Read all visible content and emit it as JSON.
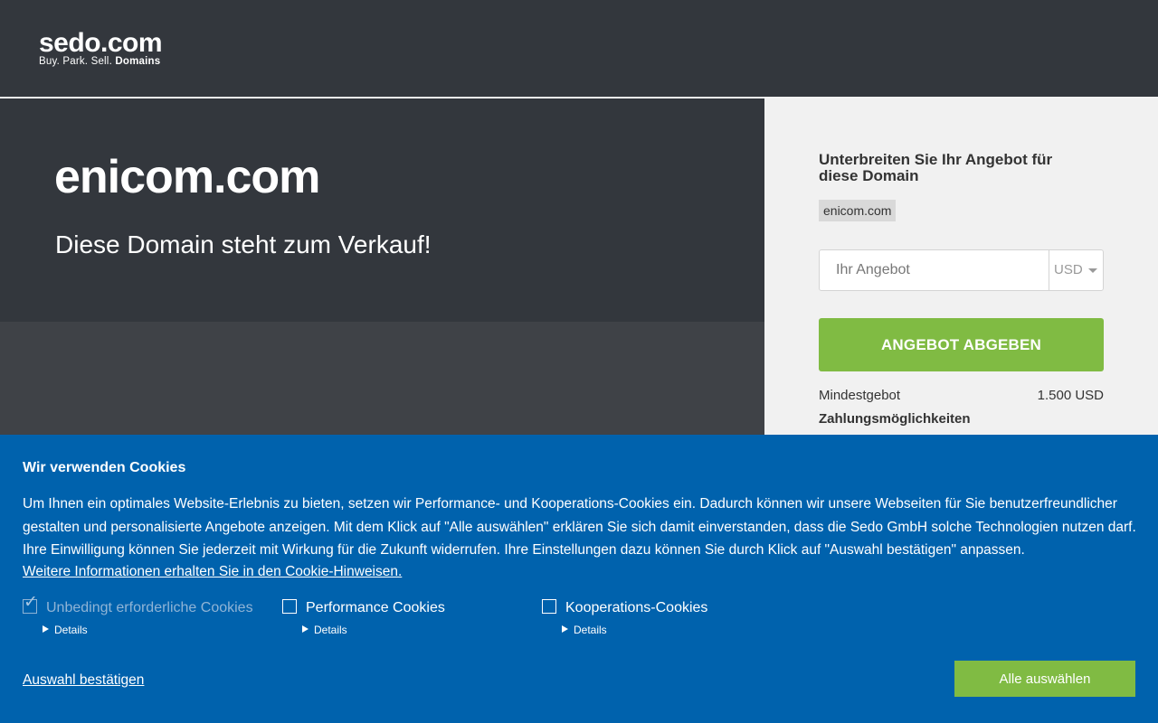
{
  "header": {
    "logo_main": "sedo.com",
    "logo_tagline_prefix": "Buy.  Park.  Sell.",
    "logo_tagline_bold": "Domains"
  },
  "hero": {
    "domain": "enicom.com",
    "subtitle": "Diese Domain steht zum Verkauf!"
  },
  "offer": {
    "heading": "Unterbreiten Sie Ihr Angebot für diese Domain",
    "domain_chip": "enicom.com",
    "input_placeholder": "Ihr Angebot",
    "currency": "USD",
    "button_label": "ANGEBOT ABGEBEN",
    "min_bid_label": "Mindestgebot",
    "min_bid_value": "1.500 USD",
    "payment_label": "Zahlungsmöglichkeiten"
  },
  "cookies": {
    "title": "Wir verwenden Cookies",
    "text": "Um Ihnen ein optimales Website-Erlebnis zu bieten, setzen wir Performance- und Kooperations-Cookies ein. Dadurch können wir unsere Webseiten für Sie benutzerfreundlicher gestalten und personalisierte Angebote anzeigen. Mit dem Klick auf \"Alle auswählen\" erklären Sie sich damit einverstanden, dass die Sedo GmbH solche Technologien nutzen darf. Ihre Einwilligung können Sie jederzeit mit Wirkung für die Zukunft widerrufen. Ihre Einstellungen dazu können Sie durch Klick auf \"Auswahl bestätigen\" anpassen.",
    "info_link": "Weitere Informationen erhalten Sie in den Cookie-Hinweisen.",
    "options": [
      {
        "label": "Unbedingt erforderliche Cookies",
        "checked": true,
        "disabled": true,
        "details": "Details"
      },
      {
        "label": "Performance Cookies",
        "checked": false,
        "disabled": false,
        "details": "Details"
      },
      {
        "label": "Kooperations-Cookies",
        "checked": false,
        "disabled": false,
        "details": "Details"
      }
    ],
    "confirm_link": "Auswahl bestätigen",
    "select_all_button": "Alle auswählen"
  }
}
